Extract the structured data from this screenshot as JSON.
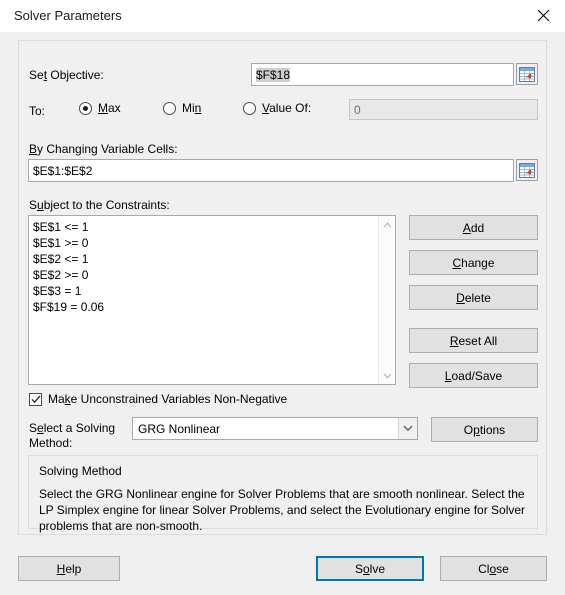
{
  "window": {
    "title": "Solver Parameters",
    "close_icon": "close-icon"
  },
  "objective": {
    "label_pre": "Se",
    "label_acc": "t",
    "label_post": " Objective:",
    "value": "$F$18",
    "range_picker_icon": "range-selector-icon"
  },
  "to_row": {
    "label": "To:",
    "options": [
      {
        "label_pre": "",
        "label_acc": "M",
        "label_post": "ax",
        "checked": true
      },
      {
        "label_pre": "Mi",
        "label_acc": "n",
        "label_post": "",
        "checked": false
      },
      {
        "label_pre": "",
        "label_acc": "V",
        "label_post": "alue Of:",
        "checked": false
      }
    ],
    "value_of": "0"
  },
  "changing_cells": {
    "label_pre": "",
    "label_acc": "B",
    "label_post": "y Changing Variable Cells:",
    "value": "$E$1:$E$2",
    "range_picker_icon": "range-selector-icon"
  },
  "constraints": {
    "label_pre": "S",
    "label_acc": "u",
    "label_post": "bject to the Constraints:",
    "items": [
      "$E$1 <= 1",
      "$E$1 >= 0",
      "$E$2 <= 1",
      "$E$2 >= 0",
      "$E$3 = 1",
      "$F$19 = 0.06"
    ],
    "scroll_up_icon": "chevron-up-icon",
    "scroll_down_icon": "chevron-down-icon"
  },
  "constraint_buttons": [
    {
      "pre": "",
      "acc": "A",
      "post": "dd",
      "name": "add-constraint-button"
    },
    {
      "pre": "",
      "acc": "C",
      "post": "hange",
      "name": "change-constraint-button"
    },
    {
      "pre": "",
      "acc": "D",
      "post": "elete",
      "name": "delete-constraint-button"
    },
    {
      "pre": "",
      "acc": "R",
      "post": "eset All",
      "name": "reset-all-button"
    },
    {
      "pre": "",
      "acc": "L",
      "post": "oad/Save",
      "name": "load-save-button"
    }
  ],
  "non_negative": {
    "label_pre": "Ma",
    "label_acc": "k",
    "label_post": "e Unconstrained Variables Non-Negative",
    "checked": true,
    "check_icon": "checkmark-icon"
  },
  "solving_method": {
    "label_pre": "S",
    "label_acc": "e",
    "label_post": "lect a Solving",
    "label_line2": "Method:",
    "selected": "GRG Nonlinear",
    "dropdown_icon": "chevron-down-icon",
    "options_button_pre": "O",
    "options_button_acc": "p",
    "options_button_post": "tions"
  },
  "method_group": {
    "title": "Solving Method",
    "description": "Select the GRG Nonlinear engine for Solver Problems that are smooth nonlinear. Select the LP Simplex engine for linear Solver Problems, and select the Evolutionary engine for Solver problems that are non-smooth."
  },
  "footer": {
    "help": {
      "pre": "",
      "acc": "H",
      "post": "elp"
    },
    "solve": {
      "pre": "S",
      "acc": "o",
      "post": "lve"
    },
    "close": {
      "pre": "Cl",
      "acc": "o",
      "post": "se"
    }
  },
  "colors": {
    "dialog_bg": "#f0f0f0",
    "accent_focus": "#0078a8",
    "button_face": "#e1e1e1",
    "field_bg": "#ffffff"
  }
}
